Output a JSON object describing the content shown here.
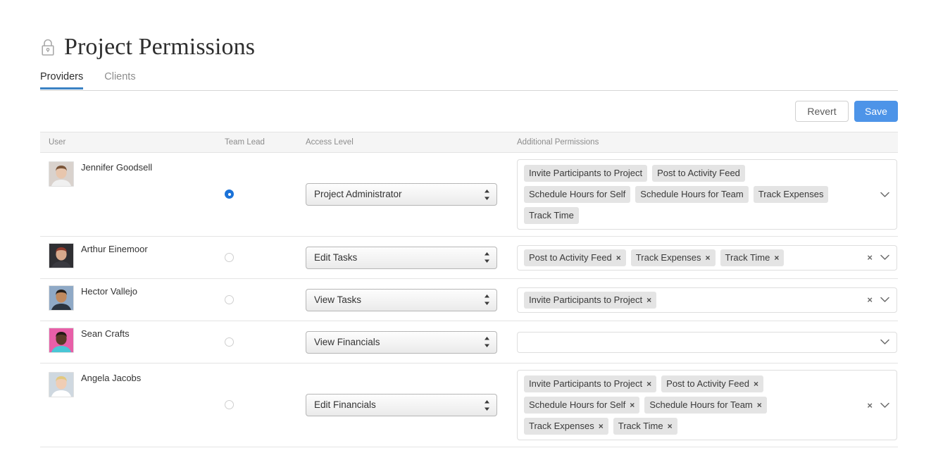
{
  "header": {
    "title": "Project Permissions",
    "lock_icon": "lock-icon"
  },
  "tabs": [
    {
      "label": "Providers",
      "active": true
    },
    {
      "label": "Clients",
      "active": false
    }
  ],
  "actions": {
    "revert_label": "Revert",
    "save_label": "Save"
  },
  "colors": {
    "save_button": "#4d94e8",
    "tab_underline": "#3b82c4",
    "radio_selected": "#1b72d8",
    "tag_background": "#e4e4e4",
    "header_background": "#f5f5f5",
    "border": "#e4e4e4"
  },
  "table": {
    "columns": [
      {
        "key": "user",
        "label": "User"
      },
      {
        "key": "team_lead",
        "label": "Team Lead"
      },
      {
        "key": "access_level",
        "label": "Access Level"
      },
      {
        "key": "additional_permissions",
        "label": "Additional Permissions"
      }
    ],
    "rows": [
      {
        "user": "Jennifer Goodsell",
        "team_lead": true,
        "access_level": "Project Administrator",
        "permissions": [
          "Invite Participants to Project",
          "Post to Activity Feed",
          "Schedule Hours for Self",
          "Schedule Hours for Team",
          "Track Expenses",
          "Track Time"
        ],
        "removable_tags": false,
        "has_clear": false
      },
      {
        "user": "Arthur Einemoor",
        "team_lead": false,
        "access_level": "Edit Tasks",
        "permissions": [
          "Post to Activity Feed",
          "Track Expenses",
          "Track Time"
        ],
        "removable_tags": true,
        "has_clear": true
      },
      {
        "user": "Hector Vallejo",
        "team_lead": false,
        "access_level": "View Tasks",
        "permissions": [
          "Invite Participants to Project"
        ],
        "removable_tags": true,
        "has_clear": true
      },
      {
        "user": "Sean Crafts",
        "team_lead": false,
        "access_level": "View Financials",
        "permissions": [],
        "removable_tags": true,
        "has_clear": false
      },
      {
        "user": "Angela Jacobs",
        "team_lead": false,
        "access_level": "Edit Financials",
        "permissions": [
          "Invite Participants to Project",
          "Post to Activity Feed",
          "Schedule Hours for Self",
          "Schedule Hours for Team",
          "Track Expenses",
          "Track Time"
        ],
        "removable_tags": true,
        "has_clear": true
      }
    ]
  },
  "icons": {
    "tag_remove": "×",
    "clear_all": "×",
    "chevron_down": "chevron-down-icon",
    "select_stepper": "select-stepper-icon"
  }
}
